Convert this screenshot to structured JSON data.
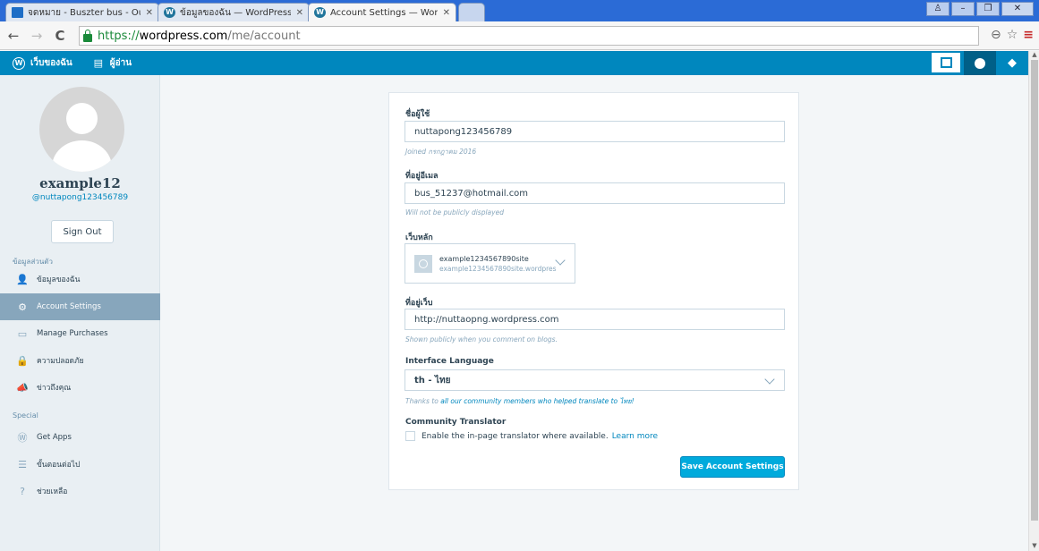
{
  "browser": {
    "tabs": [
      {
        "title": "จดหมาย - Buszter bus - Outlo",
        "icon": "mail-icon"
      },
      {
        "title": "ข้อมูลของฉัน — WordPress.co",
        "icon": "wordpress-icon"
      },
      {
        "title": "Account Settings — WordPre",
        "icon": "wordpress-icon"
      }
    ],
    "url_scheme": "https://",
    "url_host": "wordpress.com",
    "url_path": "/me/account"
  },
  "masterbar": {
    "my_sites": "เว็บของฉัน",
    "reader": "ผู้อ่าน"
  },
  "profile": {
    "display_name": "example12",
    "username": "@nuttapong123456789",
    "sign_out": "Sign Out"
  },
  "sidebar": {
    "personal_heading": "ข้อมูลส่วนตัว",
    "special_heading": "Special",
    "items": [
      {
        "label": "ข้อมูลของฉัน",
        "icon": "user-icon"
      },
      {
        "label": "Account Settings",
        "icon": "gear-icon"
      },
      {
        "label": "Manage Purchases",
        "icon": "credit-card-icon"
      },
      {
        "label": "ความปลอดภัย",
        "icon": "lock-icon"
      },
      {
        "label": "ข่าวถึงคุณ",
        "icon": "megaphone-icon"
      }
    ],
    "special_items": [
      {
        "label": "Get Apps",
        "icon": "wordpress-icon"
      },
      {
        "label": "ขั้นตอนต่อไป",
        "icon": "list-icon"
      },
      {
        "label": "ช่วยเหลือ",
        "icon": "help-icon"
      }
    ]
  },
  "form": {
    "username_label": "ชื่อผู้ใช้",
    "username_value": "nuttapong123456789",
    "username_hint": "Joined กรกฎาคม 2016",
    "email_label": "ที่อยู่อีเมล",
    "email_value": "bus_51237@hotmail.com",
    "email_hint": "Will not be publicly displayed",
    "primary_site_label": "เว็บหลัก",
    "primary_site_name": "example1234567890site",
    "primary_site_url": "example1234567890site.wordpress.com",
    "web_address_label": "ที่อยู่เว็บ",
    "web_address_value": "http://nuttaopng.wordpress.com",
    "web_address_hint": "Shown publicly when you comment on blogs.",
    "language_label": "Interface Language",
    "language_value": "th - ไทย",
    "language_hint_prefix": "Thanks to ",
    "language_hint_link": "all our community members who helped translate to ไทย!",
    "translator_label": "Community Translator",
    "translator_checkbox_label": "Enable the in-page translator where available.",
    "translator_learn_more": "Learn more",
    "save_button": "Save Account Settings"
  }
}
